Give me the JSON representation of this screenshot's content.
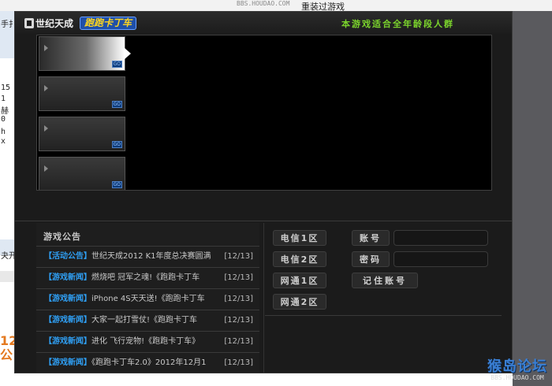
{
  "background": {
    "watermark_top": "BBS.HOUDAO.COM",
    "note_text": "重装过游戏",
    "left_fragments": [
      "手扌",
      "15",
      "1",
      "赫",
      "0",
      "h",
      "x",
      "夬开"
    ],
    "left_orange_text": "12\n公",
    "forum_watermark": {
      "title": "猴岛论坛",
      "url": "BBS.HOUDAO.COM"
    }
  },
  "launcher": {
    "brand_name": "世纪天成",
    "game_logo_text": "跑跑卡丁车",
    "age_notice": "本游戏适合全年龄段人群",
    "banner": {
      "thumbnails": [
        {
          "go_label": "GO",
          "active": true
        },
        {
          "go_label": "GO",
          "active": false
        },
        {
          "go_label": "GO",
          "active": false
        },
        {
          "go_label": "GO",
          "active": false
        }
      ]
    },
    "news": {
      "title": "游戏公告",
      "items": [
        {
          "tag": "【活动公告】",
          "text": "世纪天成2012 K1年度总决赛圆满",
          "date": "[12/13]"
        },
        {
          "tag": "【游戏新闻】",
          "text": "燃烧吧 冠军之魂!《跑跑卡丁车",
          "date": "[12/13]"
        },
        {
          "tag": "【游戏新闻】",
          "text": "iPhone 4S天天送!《跑跑卡丁车",
          "date": "[12/13]"
        },
        {
          "tag": "【游戏新闻】",
          "text": "大家一起打雪仗!《跑跑卡丁车",
          "date": "[12/13]"
        },
        {
          "tag": "【游戏新闻】",
          "text": "进化 飞行宠物!《跑跑卡丁车》",
          "date": "[12/13]"
        },
        {
          "tag": "【游戏新闻】",
          "text": "《跑跑卡丁车2.0》2012年12月1",
          "date": "[12/13]"
        }
      ]
    },
    "servers": [
      "电信1区",
      "电信2区",
      "网通1区",
      "网通2区"
    ],
    "login": {
      "account_label": "账号",
      "password_label": "密码",
      "remember_label": "记住账号",
      "account_value": "",
      "password_value": ""
    },
    "colors": {
      "accent_green": "#7bd42c",
      "news_tag_blue": "#2f9ef2",
      "window_bg": "#1b1b1b"
    }
  }
}
